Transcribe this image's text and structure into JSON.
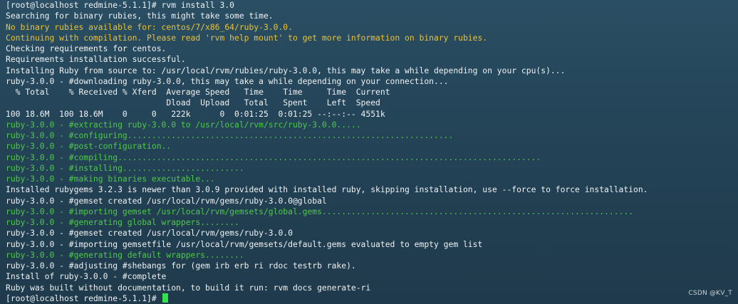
{
  "terminal": {
    "prompt": "[root@localhost redmine-5.1.1]# ",
    "command": "rvm install 3.0",
    "lines": [
      {
        "color": "white",
        "text": "Searching for binary rubies, this might take some time."
      },
      {
        "color": "yellow",
        "text": "No binary rubies available for: centos/7/x86_64/ruby-3.0.0."
      },
      {
        "color": "yellow",
        "text": "Continuing with compilation. Please read 'rvm help mount' to get more information on binary rubies."
      },
      {
        "color": "white",
        "text": "Checking requirements for centos."
      },
      {
        "color": "white",
        "text": "Requirements installation successful."
      },
      {
        "color": "white",
        "text": "Installing Ruby from source to: /usr/local/rvm/rubies/ruby-3.0.0, this may take a while depending on your cpu(s)..."
      },
      {
        "color": "white",
        "text": "ruby-3.0.0 - #downloading ruby-3.0.0, this may take a while depending on your connection..."
      },
      {
        "color": "white",
        "text": "  % Total    % Received % Xferd  Average Speed   Time    Time     Time  Current"
      },
      {
        "color": "white",
        "text": "                                 Dload  Upload   Total   Spent    Left  Speed"
      },
      {
        "color": "white",
        "text": "100 18.6M  100 18.6M    0     0   222k      0  0:01:25  0:01:25 --:--:-- 4551k"
      },
      {
        "color": "green",
        "text": "ruby-3.0.0 - #extracting ruby-3.0.0 to /usr/local/rvm/src/ruby-3.0.0....."
      },
      {
        "color": "green",
        "text": "ruby-3.0.0 - #configuring..................................................................."
      },
      {
        "color": "green",
        "text": "ruby-3.0.0 - #post-configuration.."
      },
      {
        "color": "green",
        "text": "ruby-3.0.0 - #compiling......................................................................................."
      },
      {
        "color": "green",
        "text": "ruby-3.0.0 - #installing........................."
      },
      {
        "color": "green",
        "text": "ruby-3.0.0 - #making binaries executable..."
      },
      {
        "color": "white",
        "text": "Installed rubygems 3.2.3 is newer than 3.0.9 provided with installed ruby, skipping installation, use --force to force installation."
      },
      {
        "color": "white",
        "text": "ruby-3.0.0 - #gemset created /usr/local/rvm/gems/ruby-3.0.0@global"
      },
      {
        "color": "green",
        "text": "ruby-3.0.0 - #importing gemset /usr/local/rvm/gemsets/global.gems................................................................"
      },
      {
        "color": "green",
        "text": "ruby-3.0.0 - #generating global wrappers........"
      },
      {
        "color": "white",
        "text": "ruby-3.0.0 - #gemset created /usr/local/rvm/gems/ruby-3.0.0"
      },
      {
        "color": "white",
        "text": "ruby-3.0.0 - #importing gemsetfile /usr/local/rvm/gemsets/default.gems evaluated to empty gem list"
      },
      {
        "color": "green",
        "text": "ruby-3.0.0 - #generating default wrappers........"
      },
      {
        "color": "white",
        "text": "ruby-3.0.0 - #adjusting #shebangs for (gem irb erb ri rdoc testrb rake)."
      },
      {
        "color": "white",
        "text": "Install of ruby-3.0.0 - #complete"
      },
      {
        "color": "white",
        "text": "Ruby was built without documentation, to build it run: rvm docs generate-ri"
      }
    ],
    "final_prompt": "[root@localhost redmine-5.1.1]# "
  },
  "watermark": "CSDN @KV_T",
  "colors": {
    "white": "#eef2f4",
    "yellow": "#e8c23a",
    "green": "#4ec94a",
    "cursor": "#33e24a"
  }
}
